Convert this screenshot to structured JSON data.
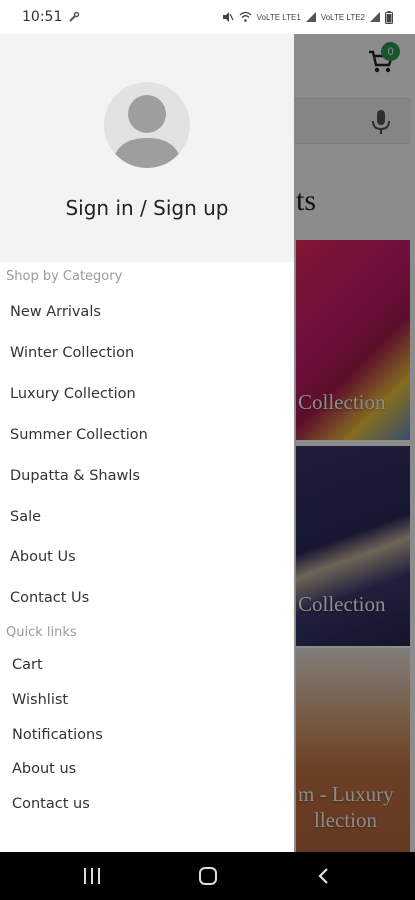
{
  "status_bar": {
    "time": "10:51",
    "carrier1": "VoLTE LTE1",
    "carrier2": "VoLTE LTE2"
  },
  "app": {
    "cart_count": "0",
    "section_heading": "ts",
    "banners": [
      {
        "label": "Collection"
      },
      {
        "label": "Collection"
      },
      {
        "label": "m - Luxury",
        "label2": "llection"
      }
    ]
  },
  "drawer": {
    "sign_in": "Sign in / Sign up",
    "shop_by_category": "Shop by Category",
    "categories": [
      "New Arrivals",
      "Winter Collection",
      "Luxury Collection",
      "Summer Collection",
      "Dupatta & Shawls",
      "Sale",
      "About Us",
      "Contact Us"
    ],
    "quick_links_label": "Quick links",
    "quick_links": [
      "Cart",
      "Wishlist",
      "Notifications",
      "About us",
      "Contact us"
    ]
  },
  "colors": {
    "badge": "#2e9b4f",
    "drawer_header": "#f3f3f3",
    "overlay": "rgba(0,0,0,0.45)"
  },
  "icons": [
    "cart-icon",
    "mic-icon",
    "avatar-icon",
    "recents-icon",
    "home-icon",
    "back-icon"
  ]
}
